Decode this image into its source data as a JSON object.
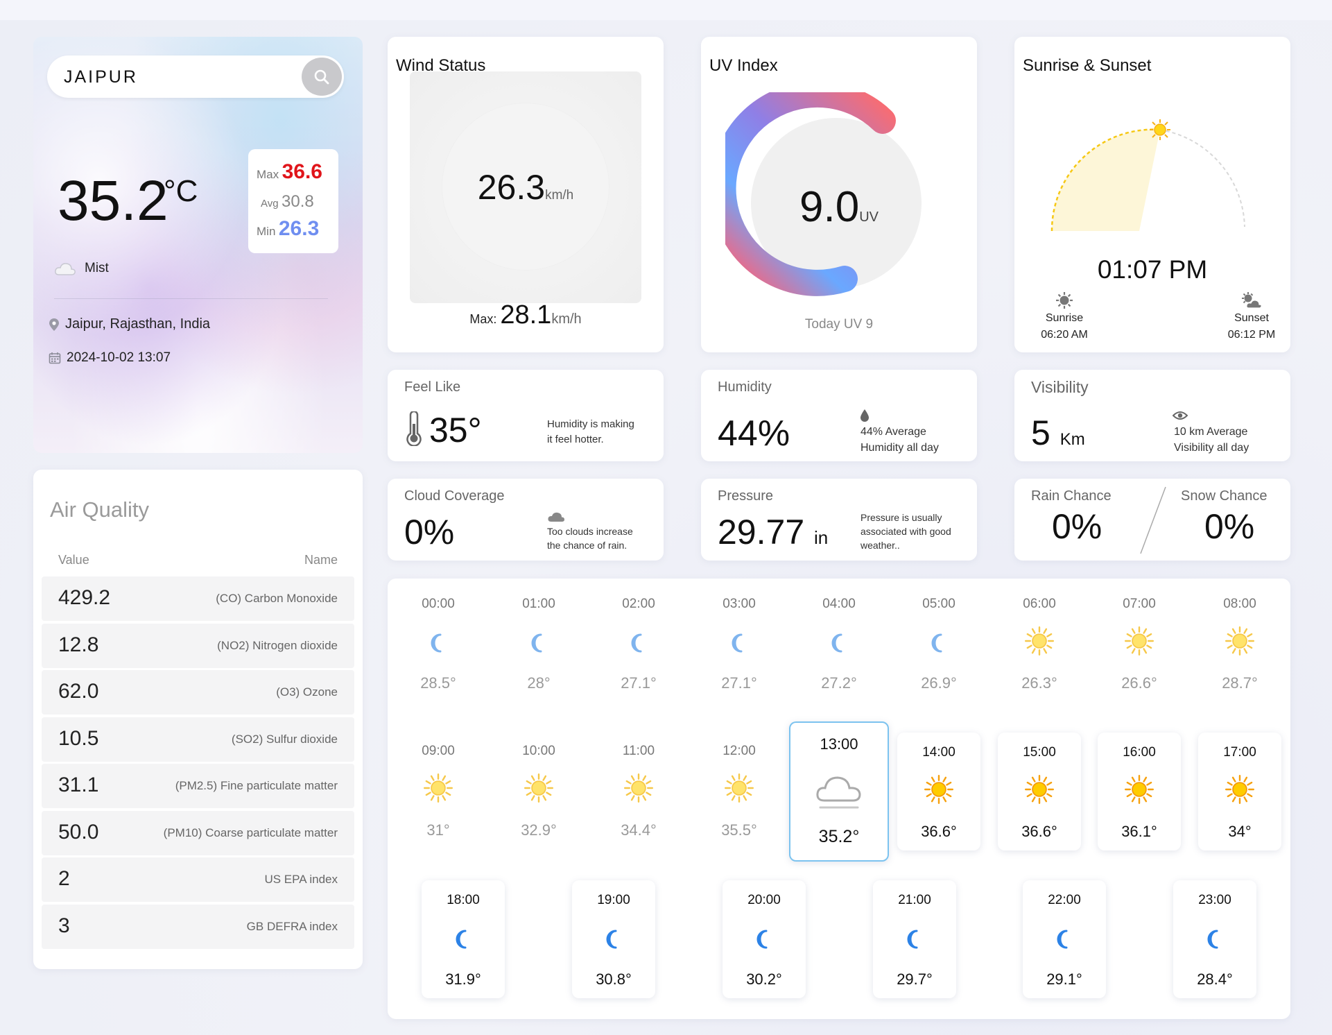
{
  "colors": {
    "accent_max": "#e0141a",
    "accent_min": "#6f8ef0",
    "sun_yellow": "#f6c815",
    "moon_blue": "#2c82e6",
    "uv_gradient_start": "#ff6b6b",
    "uv_gradient_end": "#6aa8ff",
    "selected_border": "#7cc3ef"
  },
  "search": {
    "value": "JAIPUR",
    "icon": "search-icon"
  },
  "current": {
    "temp": "35.2",
    "unit": "°C",
    "condition": "Mist",
    "condition_icon": "cloud-icon",
    "location": "Jaipur, Rajasthan, India",
    "datetime": "2024-10-02 13:07",
    "max_label": "Max",
    "max": "36.6",
    "avg_label": "Avg",
    "avg": "30.8",
    "min_label": "Min",
    "min": "26.3"
  },
  "air_quality": {
    "title": "Air Quality",
    "col_value": "Value",
    "col_name": "Name",
    "rows": [
      {
        "value": "429.2",
        "name": "(CO) Carbon Monoxide"
      },
      {
        "value": "12.8",
        "name": "(NO2) Nitrogen dioxide"
      },
      {
        "value": "62.0",
        "name": "(O3) Ozone"
      },
      {
        "value": "10.5",
        "name": "(SO2) Sulfur dioxide"
      },
      {
        "value": "31.1",
        "name": "(PM2.5) Fine particulate matter"
      },
      {
        "value": "50.0",
        "name": "(PM10) Coarse particulate matter"
      },
      {
        "value": "2",
        "name": "US EPA index"
      },
      {
        "value": "3",
        "name": "GB DEFRA index"
      }
    ]
  },
  "wind": {
    "title": "Wind Status",
    "value": "26.3",
    "unit": "km/h",
    "max_label": "Max:",
    "max": "28.1",
    "max_unit": "km/h"
  },
  "uv": {
    "title": "UV Index",
    "value": "9.0",
    "unit": "UV",
    "today": "Today UV 9"
  },
  "sun": {
    "title": "Sunrise & Sunset",
    "time": "01:07 PM",
    "sunrise_label": "Sunrise",
    "sunrise": "06:20 AM",
    "sunset_label": "Sunset",
    "sunset": "06:12 PM"
  },
  "feel": {
    "title": "Feel Like",
    "value": "35°",
    "note_1": "Humidity is making",
    "note_2": "it feel hotter."
  },
  "humidity": {
    "title": "Humidity",
    "value": "44%",
    "note_1": "44% Average",
    "note_2": "Humidity all day"
  },
  "visibility": {
    "title": "Visibility",
    "value": "5",
    "unit": "Km",
    "note_1": "10 km Average",
    "note_2": "Visibility all day"
  },
  "cloud": {
    "title": "Cloud Coverage",
    "value": "0%",
    "note_1": "Too clouds increase",
    "note_2": "the chance of rain."
  },
  "pressure": {
    "title": "Pressure",
    "value": "29.77",
    "unit": "in",
    "note_1": "Pressure is usually",
    "note_2": "associated with good",
    "note_3": "weather.."
  },
  "chance": {
    "rain_title": "Rain Chance",
    "rain": "0%",
    "snow_title": "Snow Chance",
    "snow": "0%"
  },
  "hourly": [
    {
      "time": "00:00",
      "temp": "28.5°",
      "icon": "moon-icon"
    },
    {
      "time": "01:00",
      "temp": "28°",
      "icon": "moon-icon"
    },
    {
      "time": "02:00",
      "temp": "27.1°",
      "icon": "moon-icon"
    },
    {
      "time": "03:00",
      "temp": "27.1°",
      "icon": "moon-icon"
    },
    {
      "time": "04:00",
      "temp": "27.2°",
      "icon": "moon-icon"
    },
    {
      "time": "05:00",
      "temp": "26.9°",
      "icon": "moon-icon"
    },
    {
      "time": "06:00",
      "temp": "26.3°",
      "icon": "sun-icon"
    },
    {
      "time": "07:00",
      "temp": "26.6°",
      "icon": "sun-icon"
    },
    {
      "time": "08:00",
      "temp": "28.7°",
      "icon": "sun-icon"
    },
    {
      "time": "09:00",
      "temp": "31°",
      "icon": "sun-icon"
    },
    {
      "time": "10:00",
      "temp": "32.9°",
      "icon": "sun-icon"
    },
    {
      "time": "11:00",
      "temp": "34.4°",
      "icon": "sun-icon"
    },
    {
      "time": "12:00",
      "temp": "35.5°",
      "icon": "sun-icon"
    },
    {
      "time": "13:00",
      "temp": "35.2°",
      "icon": "cloud-icon",
      "selected": true
    },
    {
      "time": "14:00",
      "temp": "36.6°",
      "icon": "sun-icon"
    },
    {
      "time": "15:00",
      "temp": "36.6°",
      "icon": "sun-icon"
    },
    {
      "time": "16:00",
      "temp": "36.1°",
      "icon": "sun-icon"
    },
    {
      "time": "17:00",
      "temp": "34°",
      "icon": "sun-icon"
    },
    {
      "time": "18:00",
      "temp": "31.9°",
      "icon": "moon-icon"
    },
    {
      "time": "19:00",
      "temp": "30.8°",
      "icon": "moon-icon"
    },
    {
      "time": "20:00",
      "temp": "30.2°",
      "icon": "moon-icon"
    },
    {
      "time": "21:00",
      "temp": "29.7°",
      "icon": "moon-icon"
    },
    {
      "time": "22:00",
      "temp": "29.1°",
      "icon": "moon-icon"
    },
    {
      "time": "23:00",
      "temp": "28.4°",
      "icon": "moon-icon"
    }
  ]
}
